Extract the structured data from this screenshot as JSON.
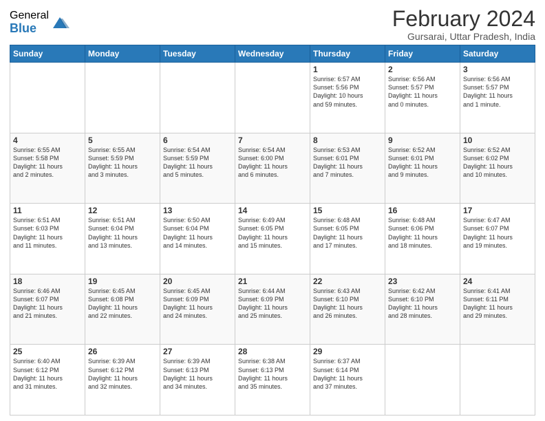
{
  "logo": {
    "general": "General",
    "blue": "Blue"
  },
  "title": "February 2024",
  "location": "Gursarai, Uttar Pradesh, India",
  "days_of_week": [
    "Sunday",
    "Monday",
    "Tuesday",
    "Wednesday",
    "Thursday",
    "Friday",
    "Saturday"
  ],
  "weeks": [
    [
      {
        "day": "",
        "info": ""
      },
      {
        "day": "",
        "info": ""
      },
      {
        "day": "",
        "info": ""
      },
      {
        "day": "",
        "info": ""
      },
      {
        "day": "1",
        "info": "Sunrise: 6:57 AM\nSunset: 5:56 PM\nDaylight: 10 hours\nand 59 minutes."
      },
      {
        "day": "2",
        "info": "Sunrise: 6:56 AM\nSunset: 5:57 PM\nDaylight: 11 hours\nand 0 minutes."
      },
      {
        "day": "3",
        "info": "Sunrise: 6:56 AM\nSunset: 5:57 PM\nDaylight: 11 hours\nand 1 minute."
      }
    ],
    [
      {
        "day": "4",
        "info": "Sunrise: 6:55 AM\nSunset: 5:58 PM\nDaylight: 11 hours\nand 2 minutes."
      },
      {
        "day": "5",
        "info": "Sunrise: 6:55 AM\nSunset: 5:59 PM\nDaylight: 11 hours\nand 3 minutes."
      },
      {
        "day": "6",
        "info": "Sunrise: 6:54 AM\nSunset: 5:59 PM\nDaylight: 11 hours\nand 5 minutes."
      },
      {
        "day": "7",
        "info": "Sunrise: 6:54 AM\nSunset: 6:00 PM\nDaylight: 11 hours\nand 6 minutes."
      },
      {
        "day": "8",
        "info": "Sunrise: 6:53 AM\nSunset: 6:01 PM\nDaylight: 11 hours\nand 7 minutes."
      },
      {
        "day": "9",
        "info": "Sunrise: 6:52 AM\nSunset: 6:01 PM\nDaylight: 11 hours\nand 9 minutes."
      },
      {
        "day": "10",
        "info": "Sunrise: 6:52 AM\nSunset: 6:02 PM\nDaylight: 11 hours\nand 10 minutes."
      }
    ],
    [
      {
        "day": "11",
        "info": "Sunrise: 6:51 AM\nSunset: 6:03 PM\nDaylight: 11 hours\nand 11 minutes."
      },
      {
        "day": "12",
        "info": "Sunrise: 6:51 AM\nSunset: 6:04 PM\nDaylight: 11 hours\nand 13 minutes."
      },
      {
        "day": "13",
        "info": "Sunrise: 6:50 AM\nSunset: 6:04 PM\nDaylight: 11 hours\nand 14 minutes."
      },
      {
        "day": "14",
        "info": "Sunrise: 6:49 AM\nSunset: 6:05 PM\nDaylight: 11 hours\nand 15 minutes."
      },
      {
        "day": "15",
        "info": "Sunrise: 6:48 AM\nSunset: 6:05 PM\nDaylight: 11 hours\nand 17 minutes."
      },
      {
        "day": "16",
        "info": "Sunrise: 6:48 AM\nSunset: 6:06 PM\nDaylight: 11 hours\nand 18 minutes."
      },
      {
        "day": "17",
        "info": "Sunrise: 6:47 AM\nSunset: 6:07 PM\nDaylight: 11 hours\nand 19 minutes."
      }
    ],
    [
      {
        "day": "18",
        "info": "Sunrise: 6:46 AM\nSunset: 6:07 PM\nDaylight: 11 hours\nand 21 minutes."
      },
      {
        "day": "19",
        "info": "Sunrise: 6:45 AM\nSunset: 6:08 PM\nDaylight: 11 hours\nand 22 minutes."
      },
      {
        "day": "20",
        "info": "Sunrise: 6:45 AM\nSunset: 6:09 PM\nDaylight: 11 hours\nand 24 minutes."
      },
      {
        "day": "21",
        "info": "Sunrise: 6:44 AM\nSunset: 6:09 PM\nDaylight: 11 hours\nand 25 minutes."
      },
      {
        "day": "22",
        "info": "Sunrise: 6:43 AM\nSunset: 6:10 PM\nDaylight: 11 hours\nand 26 minutes."
      },
      {
        "day": "23",
        "info": "Sunrise: 6:42 AM\nSunset: 6:10 PM\nDaylight: 11 hours\nand 28 minutes."
      },
      {
        "day": "24",
        "info": "Sunrise: 6:41 AM\nSunset: 6:11 PM\nDaylight: 11 hours\nand 29 minutes."
      }
    ],
    [
      {
        "day": "25",
        "info": "Sunrise: 6:40 AM\nSunset: 6:12 PM\nDaylight: 11 hours\nand 31 minutes."
      },
      {
        "day": "26",
        "info": "Sunrise: 6:39 AM\nSunset: 6:12 PM\nDaylight: 11 hours\nand 32 minutes."
      },
      {
        "day": "27",
        "info": "Sunrise: 6:39 AM\nSunset: 6:13 PM\nDaylight: 11 hours\nand 34 minutes."
      },
      {
        "day": "28",
        "info": "Sunrise: 6:38 AM\nSunset: 6:13 PM\nDaylight: 11 hours\nand 35 minutes."
      },
      {
        "day": "29",
        "info": "Sunrise: 6:37 AM\nSunset: 6:14 PM\nDaylight: 11 hours\nand 37 minutes."
      },
      {
        "day": "",
        "info": ""
      },
      {
        "day": "",
        "info": ""
      }
    ]
  ]
}
